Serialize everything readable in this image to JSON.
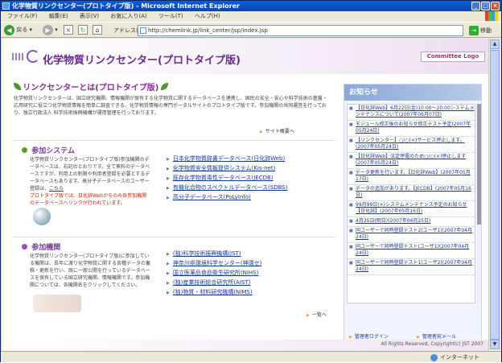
{
  "window": {
    "title": "化学物質リンクセンター(プロトタイプ版) - Microsoft Internet Explorer"
  },
  "menu": [
    "ファイル(F)",
    "編集(E)",
    "表示(V)",
    "お気に入り(A)",
    "ツール(T)",
    "ヘルプ(H)"
  ],
  "toolbar": {
    "back_label": "戻る",
    "address_label": "アドレス(D)",
    "address_value": "http://chemlink.jp/link_center/jsp/index.jsp",
    "go_label": "移動"
  },
  "status": {
    "zone": "インターネット"
  },
  "header": {
    "title": "化学物質リンクセンター(プロトタイプ版)",
    "committee_logo": "Committee Logo"
  },
  "about": {
    "title": "リンクセンターとは(プロトタイプ版)",
    "text": "化学物質リンクセンターは、国立研究機関、情報機関が保有する化学物質に関するデータベースを連携し、国民の安全・安心や科学技術の基盤・応用研究に役立つ化学物質情報を簡単に調査できる、化学物質情報の専門ポータルサイトのプロトタイプ版です。参加機関の共同運営を行っており、独立行政法人 科学技術振興機構が運用管理を行っております。",
    "link": "サイト概要へ"
  },
  "systems": {
    "title": "参加システム",
    "text": "化学物質リンクセンター(プロトタイプ版)参加機関のデータベースは、右記のとおりです。全て無料のデータベースですが、利用上の制限や利用者登録を必要とするデータベースもあります。高分子データベースのユーザー登録は、",
    "text_link": "こちら",
    "text_red": "プロトタイプ版では、日化辞Webからのみ各参加機関のデータベースへリンクが行われています。",
    "links": [
      "日本化学物質辞書データベース(日化辞Web)",
      "化学物質安全情報提供システム(Kis-net)",
      "既存化学物質毒性データベース(JECDB)",
      "有機化合物のスペクトルデータベース(SDBS)",
      "高分子データベース(PoLyInfo)"
    ]
  },
  "orgs": {
    "title": "参加機関",
    "text": "化学物質リンクセンター(プロトタイプ版)に参加している機関は、長年に渡り化学物質に関する各種データの蓄積・更新を行い、既に一般公開を行っているデータベースを保有している国立研究機関、情報機関です。参加機関については、各機関名をクリックしてください。",
    "links": [
      "(独)科学技術振興機構(JST)",
      "神奈川県環境科学センター(神環セ)",
      "国立医薬品食品衛生研究所(NIHS)",
      "(独)産業技術総合研究所(AIST)",
      "(独)物質・材料研究機構(NIMS)"
    ],
    "more": "一覧へ"
  },
  "news": {
    "title": "お知らせ",
    "items": [
      "【日化辞Web】6月22日(金)10:00〜20:00システムメンテナンスについて(2007年06月07日)",
      "モジュール修正後のお知らせ修正テスト予定(2007年05月24日)",
      "【リンクセンター】○/○(×)サービス停止します。(2007年05月24日)",
      "【日化辞Web】法定停電のため○/○(×)停止します(2007年05月24日)",
      "データ更新を行います。【日化辞Web】(2007年05月17日)",
      "データの追加があります。【JECDB】(2007年05月16日)",
      "99月99日(×)システムメンテナンス予定のお知らせ【日化辞】(2007年05月16日)",
      "4月25日(明日)(2007年04月25日)",
      "同ユーザーで同時登録テスト2(ユーザ1)(2007年04月24日)",
      "同ユーザーで同時登録テスト(ユーザ1)(2007年04月24日)",
      "同ユーザーで同時登録テスト1(ユーザ2)(2007年04月24日)"
    ],
    "login": "管理者ログイン",
    "mail": "管理者宛メール"
  },
  "footer": {
    "copyright": "All Rights Reserved, Copyright(c) JST 2007"
  }
}
